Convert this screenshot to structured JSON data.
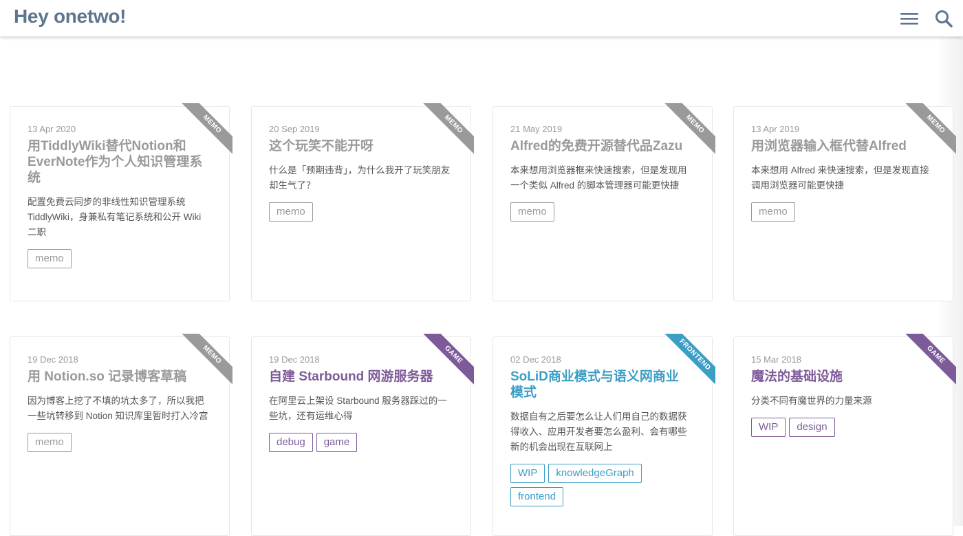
{
  "header": {
    "title": "Hey onetwo!",
    "menu_icon": "hamburger-menu-icon",
    "search_icon": "search-icon"
  },
  "colors": {
    "memo": "#9a9a9a",
    "game": "#7d5b99",
    "frontend": "#3b9ec5",
    "title": "#5e748f"
  },
  "posts": [
    {
      "date": "13 Apr 2020",
      "title": "用TiddlyWiki替代Notion和EverNote作为个人知识管理系统",
      "desc": "配置免费云同步的非线性知识管理系统 TiddlyWiki，身兼私有笔记系统和公开 Wiki 二职",
      "ribbon": "MEMO",
      "tags": [
        "memo"
      ]
    },
    {
      "date": "20 Sep 2019",
      "title": "这个玩笑不能开呀",
      "desc": "什么是「预期违背」，为什么我开了玩笑朋友却生气了？",
      "ribbon": "MEMO",
      "tags": [
        "memo"
      ]
    },
    {
      "date": "21 May 2019",
      "title": "Alfred的免费开源替代品Zazu",
      "desc": "本来想用浏览器框来快速搜索，但是发现用一个类似 Alfred 的脚本管理器可能更快捷",
      "ribbon": "MEMO",
      "tags": [
        "memo"
      ]
    },
    {
      "date": "13 Apr 2019",
      "title": "用浏览器输入框代替Alfred",
      "desc": "本来想用 Alfred 来快速搜索，但是发现直接调用浏览器可能更快捷",
      "ribbon": "MEMO",
      "tags": [
        "memo"
      ]
    },
    {
      "date": "19 Dec 2018",
      "title": "用 Notion.so 记录博客草稿",
      "desc": "因为博客上挖了不填的坑太多了，所以我把一些坑转移到 Notion 知识库里暂时打入冷宫",
      "ribbon": "MEMO",
      "tags": [
        "memo"
      ]
    },
    {
      "date": "19 Dec 2018",
      "title": "自建 Starbound 网游服务器",
      "desc": "在阿里云上架设 Starbound 服务器踩过的一些坑，还有运维心得",
      "ribbon": "GAME",
      "tags": [
        "debug",
        "game"
      ]
    },
    {
      "date": "02 Dec 2018",
      "title": "SoLiD商业模式与语义网商业模式",
      "desc": "数据自有之后要怎么让人们用自己的数据获得收入、应用开发者要怎么盈利、会有哪些新的机会出现在互联网上",
      "ribbon": "FRONTEND",
      "tags": [
        "WIP",
        "knowledgeGraph",
        "frontend"
      ]
    },
    {
      "date": "15 Mar 2018",
      "title": "魔法的基础设施",
      "desc": "分类不同有魔世界的力量来源",
      "ribbon": "GAME",
      "tags": [
        "WIP",
        "design"
      ]
    }
  ]
}
